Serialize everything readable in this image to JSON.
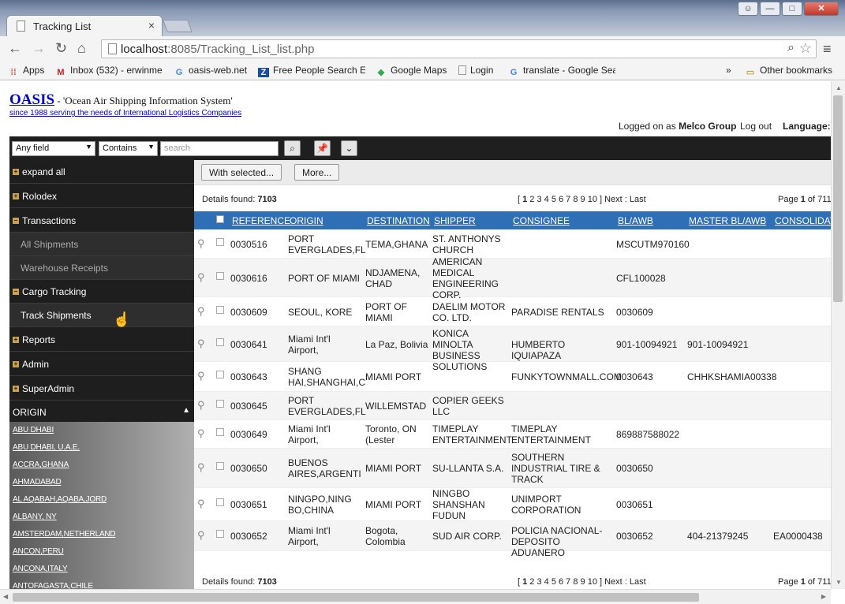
{
  "browser": {
    "tab_title": "Tracking List",
    "tab_close": "×",
    "url_host": "localhost",
    "url_path": ":8085/Tracking_List_list.php",
    "bookmarks": [
      {
        "label": "Apps",
        "icon": "apps-grid-icon",
        "color": "#dd4b39"
      },
      {
        "label": "Inbox (532) - erwinme",
        "icon": "gmail-icon",
        "color": "#c5221f"
      },
      {
        "label": "oasis-web.net",
        "icon": "google-g-icon",
        "color": "#4285f4"
      },
      {
        "label": "Free People Search En",
        "icon": "z-logo-icon",
        "color": "#1a4fa0"
      },
      {
        "label": "Google Maps",
        "icon": "google-maps-icon",
        "color": "#34a853"
      },
      {
        "label": "Login",
        "icon": "blank-page-icon",
        "color": "#777777"
      },
      {
        "label": "translate - Google Sea",
        "icon": "google-g-icon",
        "color": "#4285f4"
      }
    ],
    "overflow": "»",
    "other_bookmarks": "Other bookmarks"
  },
  "header": {
    "logo": "OASIS",
    "subtitle": " - 'Ocean Air Shipping Information System'",
    "since": "since 1988 serving the needs of International Logistics Companies",
    "logged_prefix": "Logged on as ",
    "user": "Melco Group",
    "logout": "Log out",
    "language": "Language:"
  },
  "search": {
    "field": "Any field",
    "op": "Contains",
    "placeholder": "search"
  },
  "sidebar": {
    "expand_all": "expand all",
    "rolodex": "Rolodex",
    "transactions": "Transactions",
    "all_shipments": "All Shipments",
    "warehouse_receipts": "Warehouse Receipts",
    "cargo_tracking": "Cargo Tracking",
    "track_shipments": "Track Shipments",
    "reports": "Reports",
    "admin": "Admin",
    "superadmin": "SuperAdmin",
    "origin": "ORIGIN",
    "origins": [
      "ABU DHABI",
      "ABU DHABI, U.A.E.",
      "ACCRA,GHANA",
      "AHMADABAD",
      "AL AQABAH,AQABA,JORD",
      "ALBANY, NY",
      "AMSTERDAM,NETHERLAND",
      "ANCON,PERU",
      "ANCONA,ITALY",
      "ANTOFAGASTA,CHILE"
    ]
  },
  "main": {
    "with_selected": "With selected...",
    "more": "More...",
    "details_label": "Details found: ",
    "details_count": "7103",
    "pager_open": "[ ",
    "pager_current": "1",
    "pager_rest": " 2 3 4 5 6 7 8 9 10 ] Next : Last",
    "page_label": "Page ",
    "page_num": "1",
    "page_of": " of 711",
    "columns": [
      "REFERENCE",
      "ORIGIN",
      "DESTINATION",
      "SHIPPER",
      "CONSIGNEE",
      "BL/AWB",
      "MASTER BL/AWB",
      "CONSOLIDATI"
    ],
    "rows": [
      {
        "ref": "0030516",
        "origin": "PORT\nEVERGLADES,FL",
        "dest": "TEMA,GHANA",
        "shipper": "ST. ANTHONYS\nCHURCH",
        "consignee": "",
        "bl": "MSCUTM970160",
        "master": "",
        "consol": ""
      },
      {
        "ref": "0030616",
        "origin": "PORT OF MIAMI",
        "dest": "NDJAMENA,\nCHAD",
        "shipper": "AMERICAN\nMEDICAL\nENGINEERING\nCORP.",
        "consignee": "",
        "bl": "CFL100028",
        "master": "",
        "consol": ""
      },
      {
        "ref": "0030609",
        "origin": "SEOUL, KORE",
        "dest": "PORT OF\nMIAMI",
        "shipper": "DAELIM MOTOR\nCO. LTD.",
        "consignee": "PARADISE RENTALS",
        "bl": "0030609",
        "master": "",
        "consol": ""
      },
      {
        "ref": "0030641",
        "origin": "Miami Int'l\nAirport,",
        "dest": "La Paz, Bolivia",
        "shipper": "KONICA MINOLTA\nBUSINESS\nSOLUTIONS",
        "consignee": "HUMBERTO IQUIAPAZA",
        "bl": "901-10094921",
        "master": "901-10094921",
        "consol": ""
      },
      {
        "ref": "0030643",
        "origin": "SHANG\nHAI,SHANGHAI,C",
        "dest": "MIAMI PORT",
        "shipper": "",
        "consignee": "FUNKYTOWNMALL.COM",
        "bl": "0030643",
        "master": "CHHKSHAMIA00338",
        "consol": ""
      },
      {
        "ref": "0030645",
        "origin": "PORT\nEVERGLADES,FL",
        "dest": "WILLEMSTAD",
        "shipper": "COPIER GEEKS\nLLC",
        "consignee": "",
        "bl": "",
        "master": "",
        "consol": ""
      },
      {
        "ref": "0030649",
        "origin": "Miami Int'l\nAirport,",
        "dest": "Toronto, ON\n(Lester",
        "shipper": "TIMEPLAY\nENTERTAINMENT",
        "consignee": "TIMEPLAY\nENTERTAINMENT",
        "bl": "869887588022",
        "master": "",
        "consol": ""
      },
      {
        "ref": "0030650",
        "origin": "BUENOS\nAIRES,ARGENTI",
        "dest": "MIAMI PORT",
        "shipper": "SU-LLANTA S.A.",
        "consignee": "SOUTHERN\nINDUSTRIAL TIRE &\nTRACK",
        "bl": "0030650",
        "master": "",
        "consol": ""
      },
      {
        "ref": "0030651",
        "origin": "NINGPO,NING\nBO,CHINA",
        "dest": "MIAMI PORT",
        "shipper": "NINGBO\nSHANSHAN\nFUDUN",
        "consignee": "UNIMPORT\nCORPORATION",
        "bl": "0030651",
        "master": "",
        "consol": ""
      },
      {
        "ref": "0030652",
        "origin": "Miami Int'l\nAirport,",
        "dest": "Bogota,\nColombia",
        "shipper": "SUD AIR CORP.",
        "consignee": "POLICIA NACIONAL-\nDEPOSITO ADUANERO",
        "bl": "0030652",
        "master": "404-21379245",
        "consol": "EA0000438"
      }
    ]
  },
  "colors": {
    "accent": "#2f6fb5",
    "sidebar": "#1e1e1e",
    "logo": "#0000cc"
  }
}
